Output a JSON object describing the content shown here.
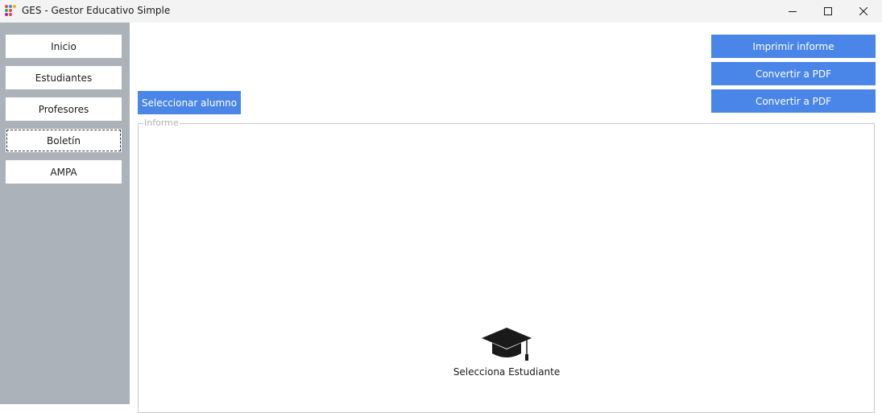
{
  "window": {
    "title": "GES - Gestor Educativo Simple",
    "icon": "ges-logo-icon",
    "controls": [
      "minimize-icon",
      "maximize-icon",
      "close-icon"
    ]
  },
  "sidebar": {
    "items": [
      {
        "label": "Inicio"
      },
      {
        "label": "Estudiantes"
      },
      {
        "label": "Profesores"
      },
      {
        "label": "Boletín",
        "active": true
      },
      {
        "label": "AMPA"
      }
    ]
  },
  "toolbar": {
    "print_label": "Imprimir informe",
    "pdf_label_1": "Convertir a PDF",
    "pdf_label_2": "Convertir a PDF",
    "select_student_label": "Seleccionar alumno"
  },
  "report": {
    "legend": "Informe",
    "empty_icon": "graduation-cap-icon",
    "empty_text": "Selecciona Estudiante"
  },
  "colors": {
    "accent": "#4a86e8",
    "sidebar_bg": "#abb2b9",
    "titlebar_bg": "#f3f3f3"
  }
}
